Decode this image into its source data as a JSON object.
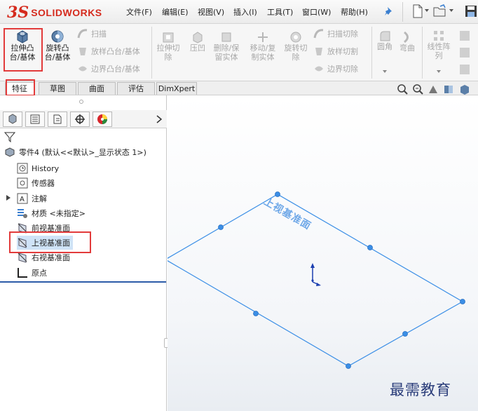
{
  "app": {
    "brand_ds": "3S",
    "brand_name": "SOLIDWORKS"
  },
  "menu": [
    {
      "label": "文件(F)"
    },
    {
      "label": "编辑(E)"
    },
    {
      "label": "视图(V)"
    },
    {
      "label": "插入(I)"
    },
    {
      "label": "工具(T)"
    },
    {
      "label": "窗口(W)"
    },
    {
      "label": "帮助(H)"
    }
  ],
  "commands": {
    "extrude_boss": "拉伸凸\n台/基体",
    "revolve_boss": "旋转凸\n台/基体",
    "sweep": "扫描",
    "loft_boss": "放样凸台/基体",
    "boundary_boss": "边界凸台/基体",
    "extrude_cut": "拉伸切\n除",
    "indent": "压凹",
    "delete_body": "删除/保\n留实体",
    "move_copy": "移动/复\n制实体",
    "revolve_cut": "旋转切\n除",
    "swept_cut": "扫描切除",
    "lofted_cut": "放样切割",
    "boundary_cut": "边界切除",
    "fillet": "圆角",
    "flex": "弯曲",
    "linear_pattern": "线性阵\n列"
  },
  "tabs": [
    {
      "label": "特征"
    },
    {
      "label": "草图"
    },
    {
      "label": "曲面"
    },
    {
      "label": "评估"
    },
    {
      "label": "DimXpert"
    }
  ],
  "tree": {
    "root": "零件4  (默认<<默认>_显示状态 1>)",
    "items": [
      {
        "label": "History",
        "icon": "history-icon"
      },
      {
        "label": "传感器",
        "icon": "sensor-icon"
      },
      {
        "label": "注解",
        "icon": "annotation-icon"
      },
      {
        "label": "材质 <未指定>",
        "icon": "material-icon"
      },
      {
        "label": "前视基准面",
        "icon": "plane-icon"
      },
      {
        "label": "上视基准面",
        "icon": "plane-icon"
      },
      {
        "label": "右视基准面",
        "icon": "plane-icon"
      },
      {
        "label": "原点",
        "icon": "origin-icon"
      }
    ]
  },
  "viewport": {
    "plane_label": "上视基准面"
  },
  "watermark": "最需教育",
  "colors": {
    "brand": "#d52b1e",
    "highlight": "#e23b3b",
    "plane": "#3a8ee6",
    "selected_row": "#cfe3f7"
  }
}
